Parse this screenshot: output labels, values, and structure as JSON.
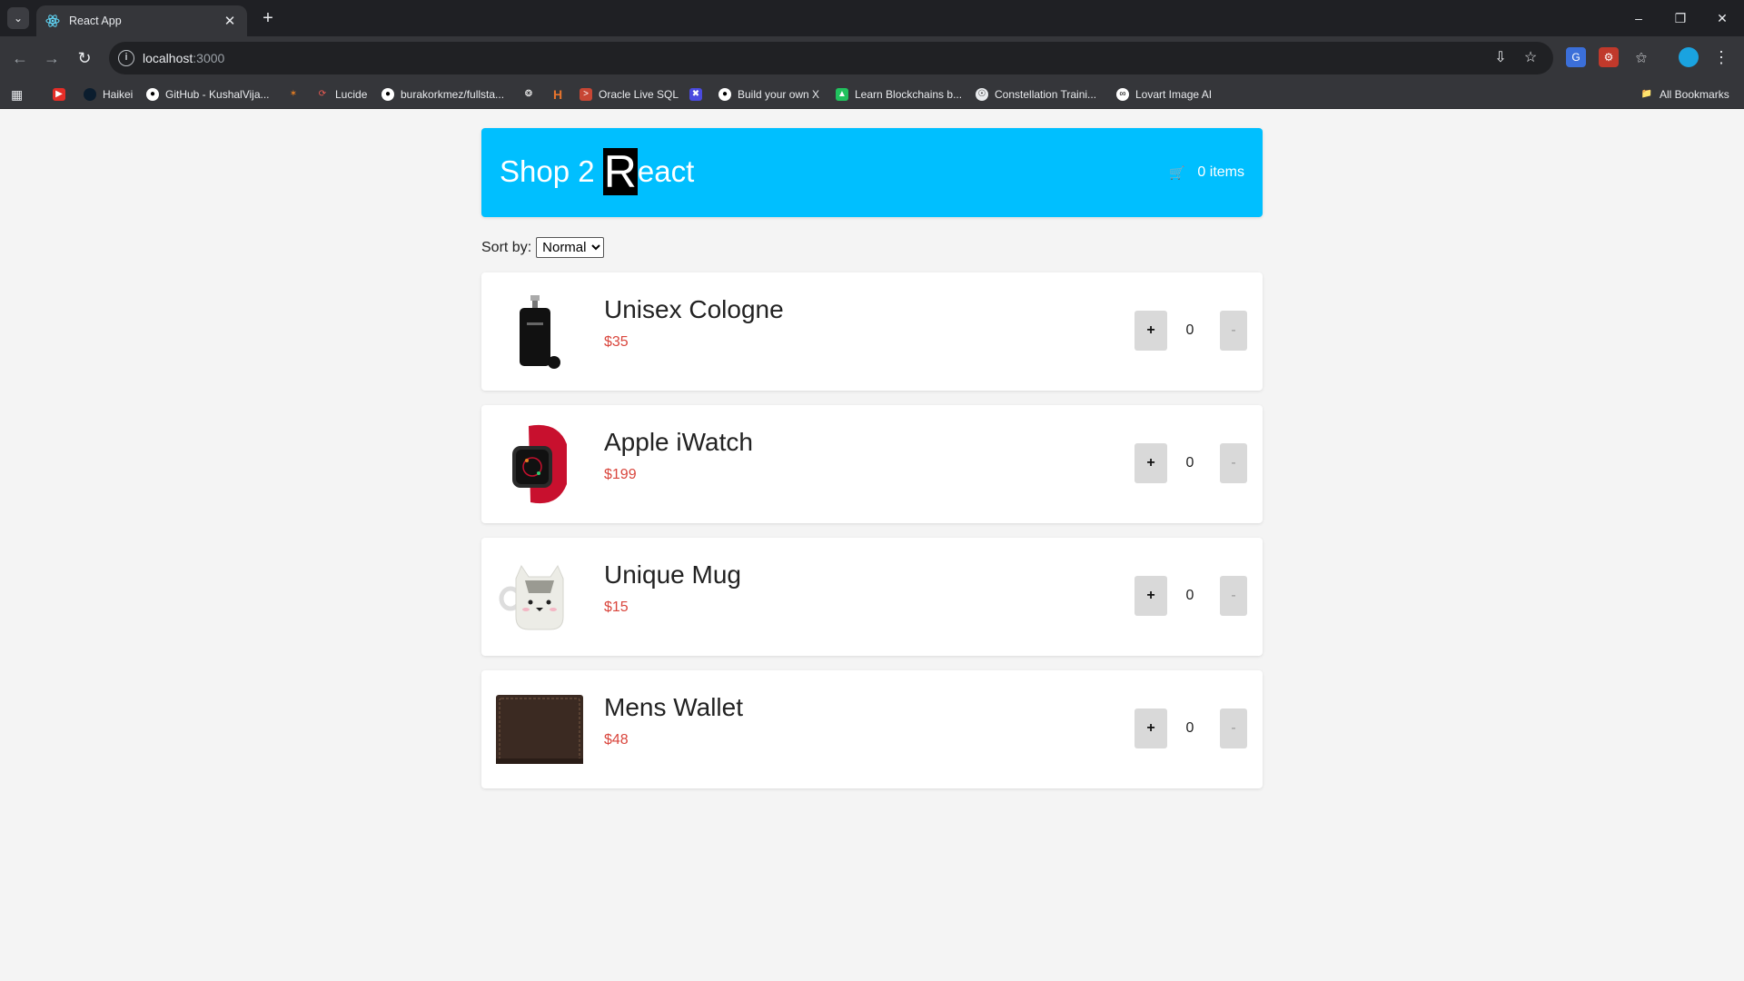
{
  "browser": {
    "tab_title": "React App",
    "url_host": "localhost",
    "url_port": ":3000",
    "bookmarks": [
      {
        "label": "",
        "icon": "youtube-icon"
      },
      {
        "label": "Haikei",
        "icon": "haikei-icon"
      },
      {
        "label": "GitHub - KushalVija...",
        "icon": "github-icon"
      },
      {
        "label": "",
        "icon": "sparkle-icon"
      },
      {
        "label": "Lucide",
        "icon": "lucide-icon"
      },
      {
        "label": "burakorkmez/fullsta...",
        "icon": "github-icon"
      },
      {
        "label": "",
        "icon": "openai-icon"
      },
      {
        "label": "",
        "icon": "h-icon"
      },
      {
        "label": "Oracle Live SQL",
        "icon": "oracle-icon"
      },
      {
        "label": "",
        "icon": "x-icon"
      },
      {
        "label": "Build your own X",
        "icon": "github-icon"
      },
      {
        "label": "Learn Blockchains b...",
        "icon": "blockchain-icon"
      },
      {
        "label": "Constellation Traini...",
        "icon": "constellation-icon"
      },
      {
        "label": "Lovart Image AI",
        "icon": "lovart-icon"
      }
    ],
    "all_bookmarks_label": "All Bookmarks"
  },
  "header": {
    "brand_prefix": "Shop 2 ",
    "brand_highlight": "R",
    "brand_rest": "eact",
    "cart_label": "0 items"
  },
  "sort": {
    "label": "Sort by:",
    "options": [
      "Normal"
    ],
    "selected": "Normal"
  },
  "products": [
    {
      "name": "Unisex Cologne",
      "price": "$35",
      "quantity": "0",
      "plus": "+",
      "minus": "-",
      "image": "cologne-image"
    },
    {
      "name": "Apple iWatch",
      "price": "$199",
      "quantity": "0",
      "plus": "+",
      "minus": "-",
      "image": "watch-image"
    },
    {
      "name": "Unique Mug",
      "price": "$15",
      "quantity": "0",
      "plus": "+",
      "minus": "-",
      "image": "mug-image"
    },
    {
      "name": "Mens Wallet",
      "price": "$48",
      "quantity": "0",
      "plus": "+",
      "minus": "-",
      "image": "wallet-image"
    }
  ],
  "colors": {
    "header_bg": "#00bfff",
    "price": "#d9453c",
    "button_bg": "#d9d9d9",
    "page_bg": "#f4f4f4"
  }
}
